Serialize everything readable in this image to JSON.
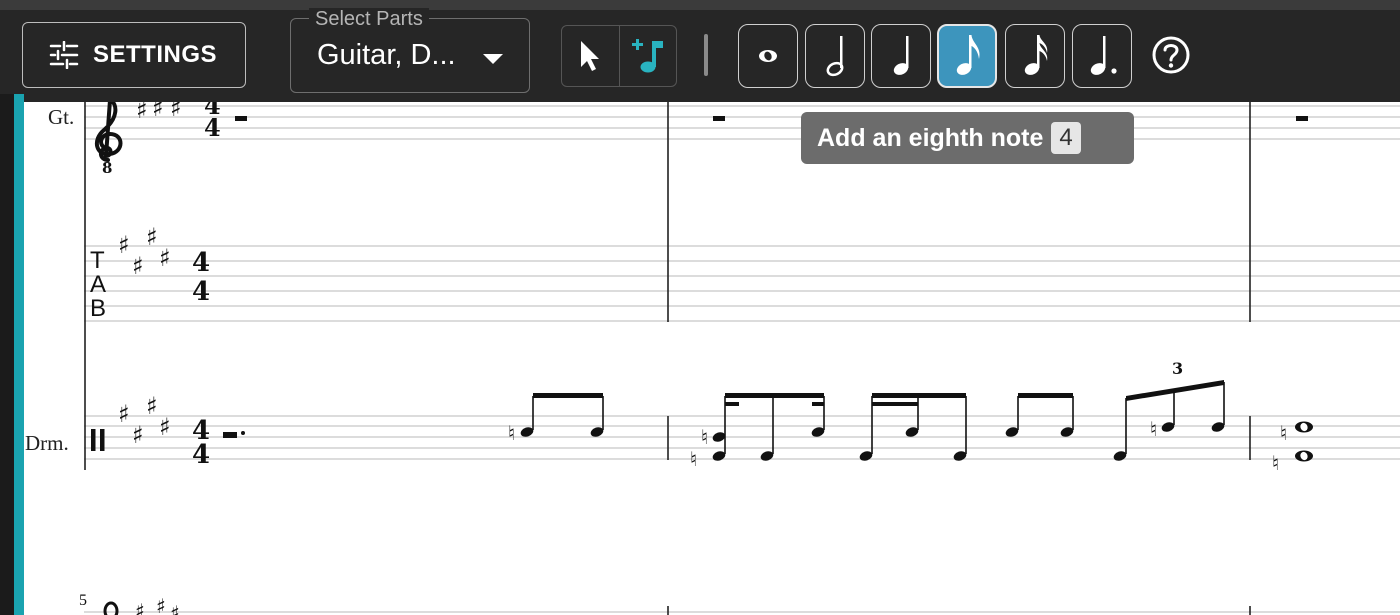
{
  "toolbar": {
    "settings_label": "SETTINGS",
    "select_parts": {
      "legend": "Select Parts",
      "value": "Guitar, D..."
    },
    "modes": [
      {
        "name": "select-mode",
        "icon": "cursor-arrow-icon"
      },
      {
        "name": "note-input-mode",
        "icon": "add-note-icon",
        "active": true
      }
    ],
    "note_durations": [
      {
        "name": "whole",
        "icon": "whole-note-icon"
      },
      {
        "name": "half",
        "icon": "half-note-icon"
      },
      {
        "name": "quarter",
        "icon": "quarter-note-icon"
      },
      {
        "name": "eighth",
        "icon": "eighth-note-icon",
        "active": true
      },
      {
        "name": "sixteenth",
        "icon": "sixteenth-note-icon"
      },
      {
        "name": "dotted",
        "icon": "dotted-note-icon"
      }
    ],
    "help_icon": "help-circle-icon"
  },
  "tooltip": {
    "text": "Add an eighth note",
    "shortcut": "4"
  },
  "score": {
    "guitar_label": "Gt.",
    "tab_letters": [
      "T",
      "A",
      "B"
    ],
    "drums_label": "Drm.",
    "time_signature": {
      "numerator": "4",
      "denominator": "4"
    },
    "octave_marker": "8",
    "tuplet_number": "3",
    "next_system_measure": "5"
  },
  "colors": {
    "toolbar_bg": "#262626",
    "accent": "#3d95bd",
    "teal": "#1aa3b0",
    "tooltip_bg": "#6c6c6c"
  }
}
